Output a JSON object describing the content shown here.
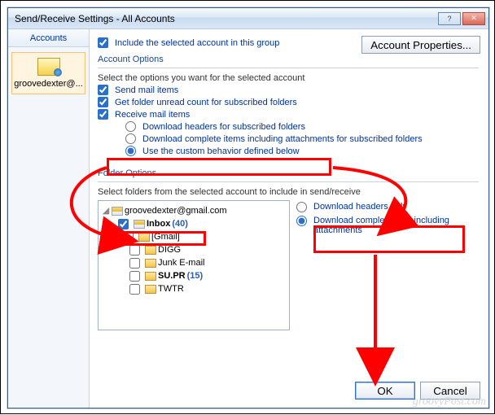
{
  "window_title": "Send/Receive Settings - All Accounts",
  "accounts": {
    "header": "Accounts",
    "item_label": "groovedexter@..."
  },
  "top_check_label": "Include the selected account in this group",
  "props_button": "Account Properties...",
  "account_options": {
    "heading": "Account Options",
    "instruction": "Select the options you want for the selected account",
    "send_mail": "Send mail items",
    "get_folder_unread": "Get folder unread count for subscribed folders",
    "receive_mail": "Receive mail items",
    "dl_headers_sub": "Download headers for subscribed folders",
    "dl_complete_sub": "Download complete items including attachments for subscribed folders",
    "use_custom": "Use the custom behavior defined below"
  },
  "folder_options": {
    "heading": "Folder Options",
    "instruction": "Select folders from the selected account to include in send/receive",
    "root": "groovedexter@gmail.com",
    "inbox": {
      "label": "Inbox",
      "count": "(40)"
    },
    "gmail": "[Gmail]",
    "digg": "DIGG",
    "junk": "Junk E-mail",
    "supr": {
      "label": "SU.PR",
      "count": "(15)"
    },
    "twtr": "TWTR",
    "radio_headers": "Download headers only",
    "radio_complete": "Download complete item including attachments"
  },
  "buttons": {
    "ok": "OK",
    "cancel": "Cancel"
  },
  "watermark": "groovyPost.com"
}
